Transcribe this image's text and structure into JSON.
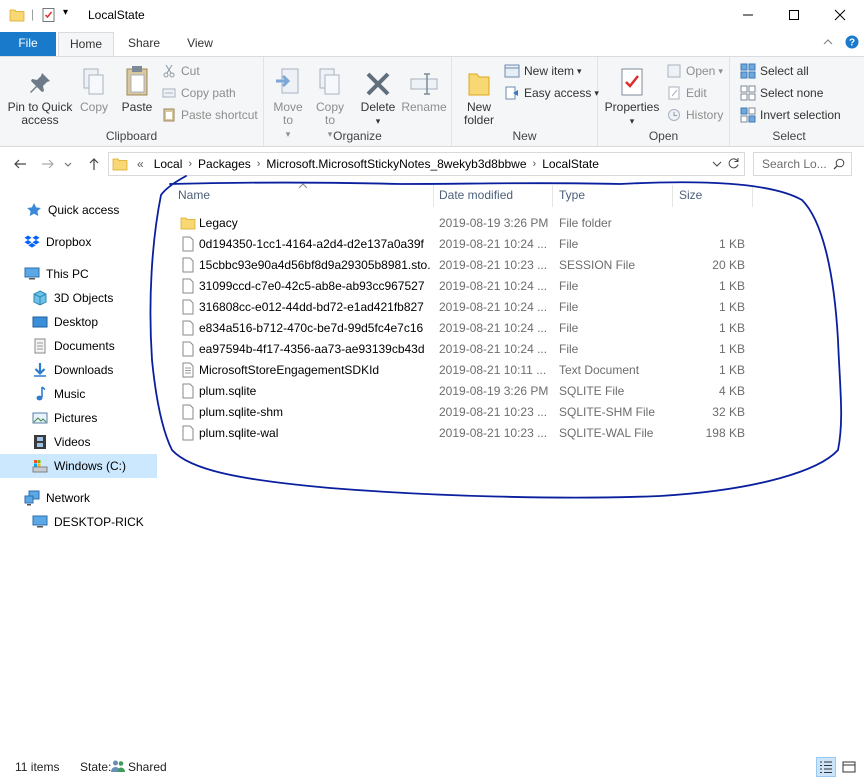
{
  "window": {
    "title": "LocalState",
    "controls": [
      "minimize",
      "maximize",
      "close"
    ]
  },
  "ribbon_tabs": [
    {
      "label": "File"
    },
    {
      "label": "Home"
    },
    {
      "label": "Share"
    },
    {
      "label": "View"
    }
  ],
  "ribbon": {
    "clipboard": {
      "label": "Clipboard",
      "pin": "Pin to Quick access",
      "copy": "Copy",
      "paste": "Paste",
      "cut": "Cut",
      "copy_path": "Copy path",
      "paste_shortcut": "Paste shortcut"
    },
    "organize": {
      "label": "Organize",
      "move_to": "Move to",
      "copy_to": "Copy to",
      "delete": "Delete",
      "rename": "Rename"
    },
    "new": {
      "label": "New",
      "new_folder": "New folder",
      "new_item": "New item",
      "easy_access": "Easy access"
    },
    "open": {
      "label": "Open",
      "properties": "Properties",
      "open": "Open",
      "edit": "Edit",
      "history": "History"
    },
    "select": {
      "label": "Select",
      "select_all": "Select all",
      "select_none": "Select none",
      "invert": "Invert selection"
    }
  },
  "address": {
    "overflow": "«",
    "crumbs": [
      "Local",
      "Packages",
      "Microsoft.MicrosoftStickyNotes_8wekyb3d8bbwe",
      "LocalState"
    ],
    "search_placeholder": "Search Lo..."
  },
  "nav": {
    "quick_access": "Quick access",
    "dropbox": "Dropbox",
    "this_pc": "This PC",
    "objects3d": "3D Objects",
    "desktop": "Desktop",
    "documents": "Documents",
    "downloads": "Downloads",
    "music": "Music",
    "pictures": "Pictures",
    "videos": "Videos",
    "windows_c": "Windows (C:)",
    "network": "Network",
    "desktop_rick": "DESKTOP-RICK"
  },
  "columns": {
    "name": "Name",
    "date": "Date modified",
    "type": "Type",
    "size": "Size"
  },
  "files": [
    {
      "name": "Legacy",
      "date": "2019-08-19 3:26 PM",
      "type": "File folder",
      "size": "",
      "icon": "folder"
    },
    {
      "name": "0d194350-1cc1-4164-a2d4-d2e137a0a39f",
      "date": "2019-08-21 10:24 ...",
      "type": "File",
      "size": "1 KB",
      "icon": "file"
    },
    {
      "name": "15cbbc93e90a4d56bf8d9a29305b8981.sto...",
      "date": "2019-08-21 10:23 ...",
      "type": "SESSION File",
      "size": "20 KB",
      "icon": "file"
    },
    {
      "name": "31099ccd-c7e0-42c5-ab8e-ab93cc967527",
      "date": "2019-08-21 10:24 ...",
      "type": "File",
      "size": "1 KB",
      "icon": "file"
    },
    {
      "name": "316808cc-e012-44dd-bd72-e1ad421fb827",
      "date": "2019-08-21 10:24 ...",
      "type": "File",
      "size": "1 KB",
      "icon": "file"
    },
    {
      "name": "e834a516-b712-470c-be7d-99d5fc4e7c16",
      "date": "2019-08-21 10:24 ...",
      "type": "File",
      "size": "1 KB",
      "icon": "file"
    },
    {
      "name": "ea97594b-4f17-4356-aa73-ae93139cb43d",
      "date": "2019-08-21 10:24 ...",
      "type": "File",
      "size": "1 KB",
      "icon": "file"
    },
    {
      "name": "MicrosoftStoreEngagementSDKId",
      "date": "2019-08-21 10:11 ...",
      "type": "Text Document",
      "size": "1 KB",
      "icon": "text"
    },
    {
      "name": "plum.sqlite",
      "date": "2019-08-19 3:26 PM",
      "type": "SQLITE File",
      "size": "4 KB",
      "icon": "file"
    },
    {
      "name": "plum.sqlite-shm",
      "date": "2019-08-21 10:23 ...",
      "type": "SQLITE-SHM File",
      "size": "32 KB",
      "icon": "file"
    },
    {
      "name": "plum.sqlite-wal",
      "date": "2019-08-21 10:23 ...",
      "type": "SQLITE-WAL File",
      "size": "198 KB",
      "icon": "file"
    }
  ],
  "status": {
    "items": "11 items",
    "state_label": "State:",
    "state_value": "Shared"
  },
  "colors": {
    "accent": "#1979ca",
    "annotation": "#0a1f9e",
    "selected": "#cce8ff"
  }
}
